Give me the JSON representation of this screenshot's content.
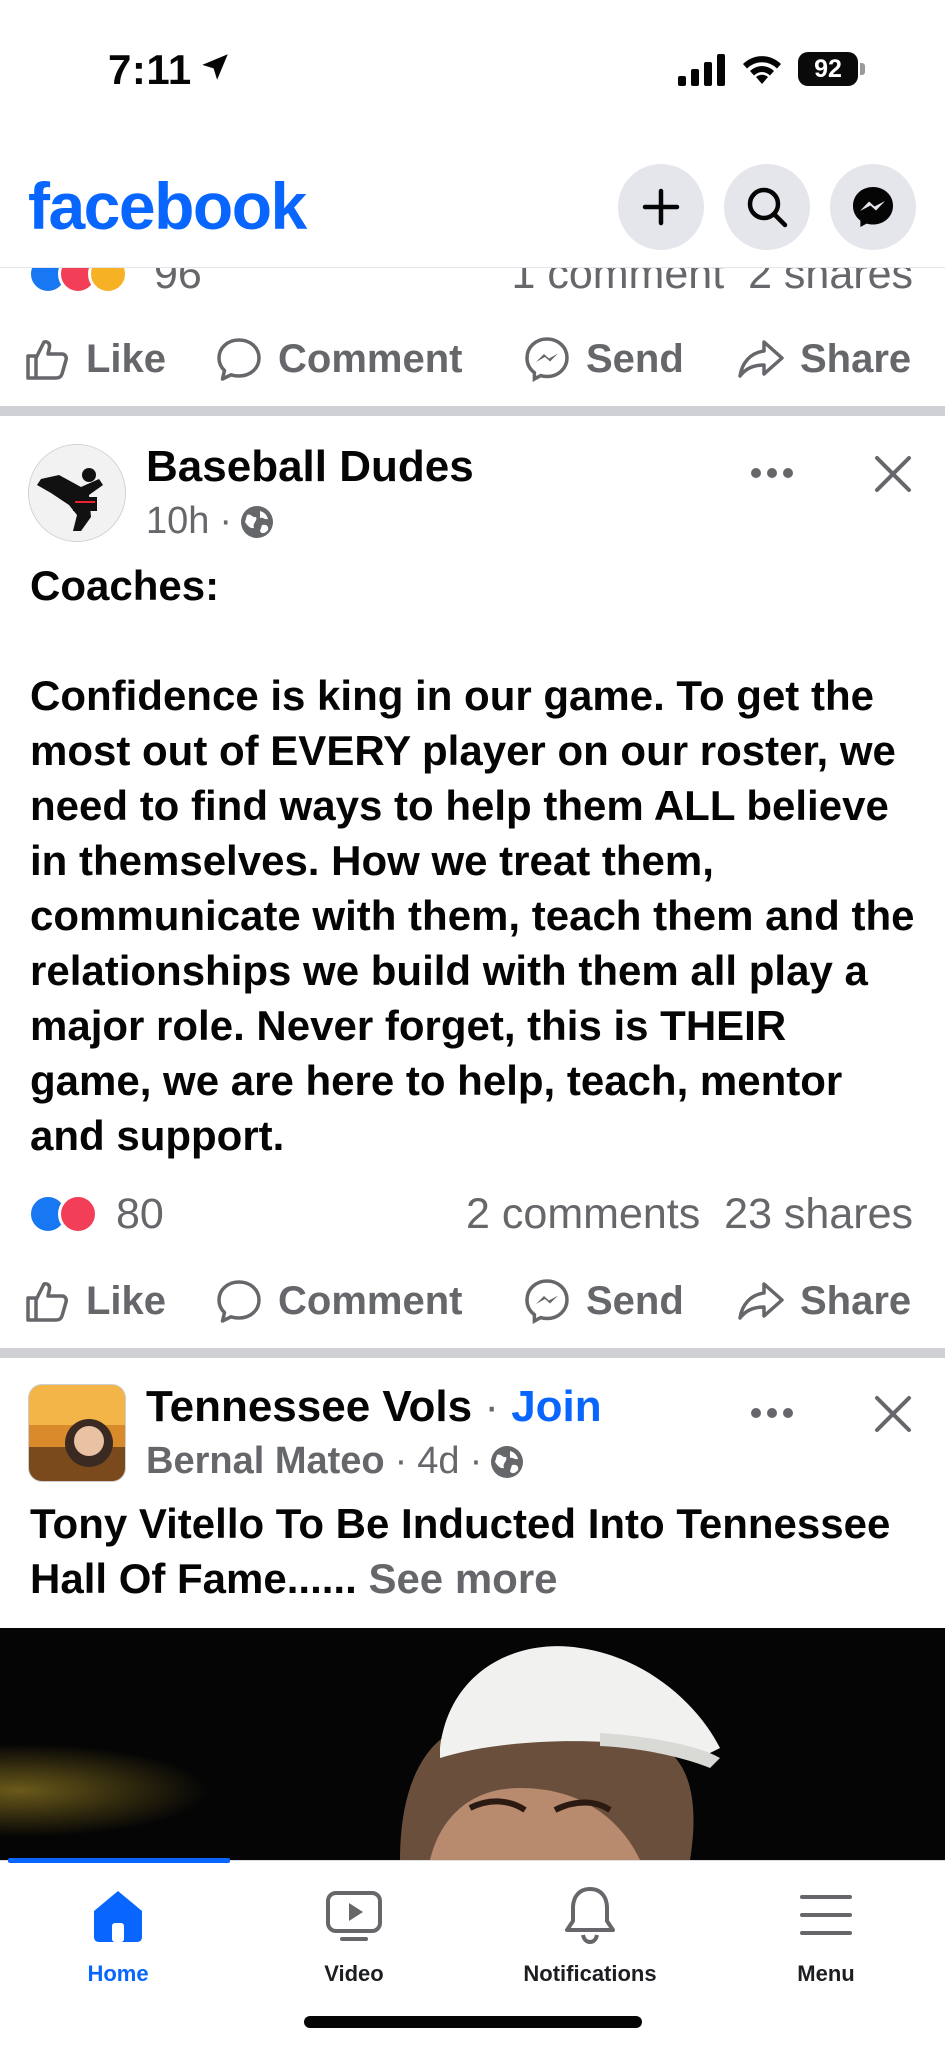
{
  "status_bar": {
    "time": "7:11",
    "battery": "92"
  },
  "header": {
    "logo": "facebook",
    "buttons": [
      "plus-icon",
      "search-icon",
      "messenger-icon"
    ]
  },
  "top_post_partial": {
    "reaction_count": "96",
    "comments": "1 comment",
    "shares": "2 shares",
    "reactions": [
      "like",
      "love",
      "wow"
    ]
  },
  "actions": {
    "like": "Like",
    "comment": "Comment",
    "send": "Send",
    "share": "Share"
  },
  "post1": {
    "page_name": "Baseball Dudes",
    "time": "10h",
    "separator": "·",
    "text": "Coaches:\n\nConfidence is king in our game. To get the most out of EVERY player on our roster, we need to find ways to help them ALL believe in themselves. How we treat them, communicate with them, teach them and the relationships we build with them all play a major role. Never forget, this is THEIR game, we are here to help, teach, mentor and support.",
    "reaction_count": "80",
    "comments": "2 comments",
    "shares": "23 shares",
    "reactions": [
      "like",
      "love"
    ]
  },
  "post2": {
    "group_name": "Tennessee Vols",
    "join_label": "Join",
    "separator": "·",
    "author": "Bernal Mateo",
    "time": "4d",
    "text": "Tony Vitello To Be Inducted Into Tennessee Hall Of Fame......",
    "see_more": "See more"
  },
  "bottom_nav": {
    "items": [
      {
        "label": "Home",
        "icon": "home-icon",
        "active": true
      },
      {
        "label": "Video",
        "icon": "video-icon",
        "active": false
      },
      {
        "label": "Notifications",
        "icon": "bell-icon",
        "active": false
      },
      {
        "label": "Menu",
        "icon": "menu-icon",
        "active": false
      }
    ]
  },
  "colors": {
    "brand": "#0866ff",
    "muted": "#65676b",
    "separator": "#ced0d4"
  }
}
